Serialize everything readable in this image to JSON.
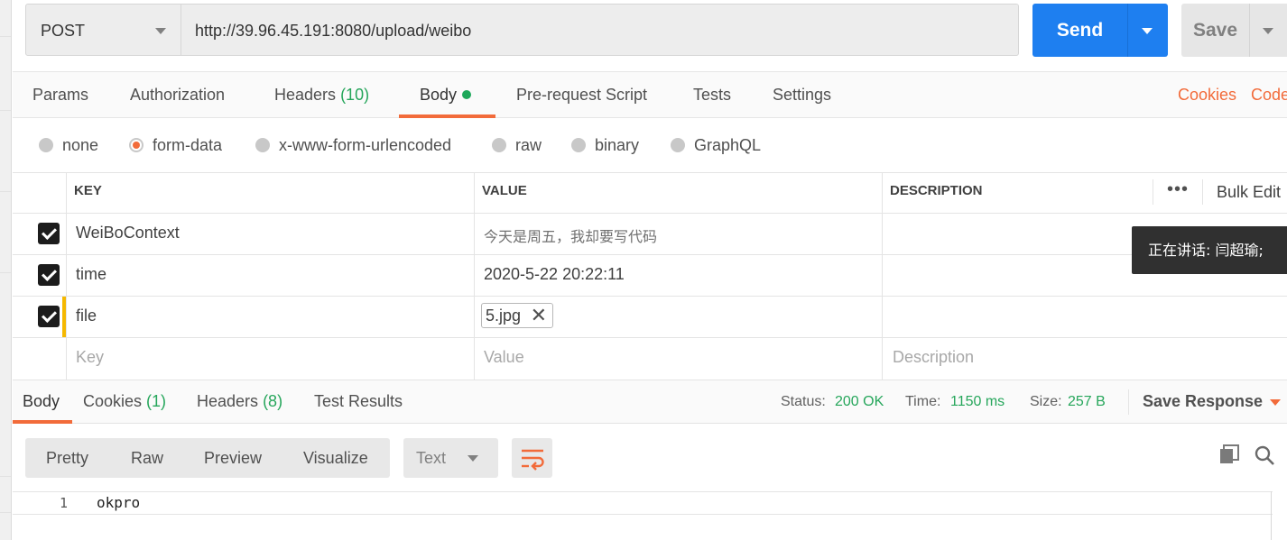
{
  "request": {
    "method": "POST",
    "url": "http://39.96.45.191:8080/upload/weibo",
    "send_label": "Send",
    "save_label": "Save"
  },
  "req_tabs": {
    "params": "Params",
    "authorization": "Authorization",
    "headers": "Headers",
    "headers_count": "(10)",
    "body": "Body",
    "prerequest": "Pre-request Script",
    "tests": "Tests",
    "settings": "Settings",
    "cookies": "Cookies",
    "code": "Code"
  },
  "body_types": {
    "none": "none",
    "form_data": "form-data",
    "urlencoded": "x-www-form-urlencoded",
    "raw": "raw",
    "binary": "binary",
    "graphql": "GraphQL",
    "selected": "form-data"
  },
  "table": {
    "headers": {
      "key": "KEY",
      "value": "VALUE",
      "description": "DESCRIPTION"
    },
    "bulk_edit": "Bulk Edit",
    "rows": [
      {
        "key": "WeiBoContext",
        "value": "今天是周五，我却要写代码",
        "checked": true
      },
      {
        "key": "time",
        "value": "2020-5-22 20:22:11",
        "checked": true
      },
      {
        "key": "file",
        "value": "5.jpg",
        "checked": true
      }
    ],
    "placeholders": {
      "key": "Key",
      "value": "Value",
      "description": "Description"
    }
  },
  "tooltip": "正在讲话: 闫超瑜;",
  "response": {
    "tabs": {
      "body": "Body",
      "cookies": "Cookies",
      "cookies_count": "(1)",
      "headers": "Headers",
      "headers_count": "(8)",
      "test_results": "Test Results"
    },
    "status_label": "Status:",
    "status_value": "200 OK",
    "time_label": "Time:",
    "time_value": "1150 ms",
    "size_label": "Size:",
    "size_value": "257 B",
    "save_response": "Save Response",
    "view_modes": {
      "pretty": "Pretty",
      "raw": "Raw",
      "preview": "Preview",
      "visualize": "Visualize"
    },
    "format": "Text",
    "lines": [
      {
        "num": "1",
        "text": "okpro"
      }
    ]
  },
  "colors": {
    "accent": "#f26b3a",
    "send_blue": "#1e7ff0",
    "success_green": "#26a65b"
  },
  "icons": [
    "chevron-down-icon",
    "checkbox-checked-icon",
    "close-icon",
    "more-icon",
    "wrap-lines-icon",
    "copy-icon",
    "search-icon"
  ]
}
